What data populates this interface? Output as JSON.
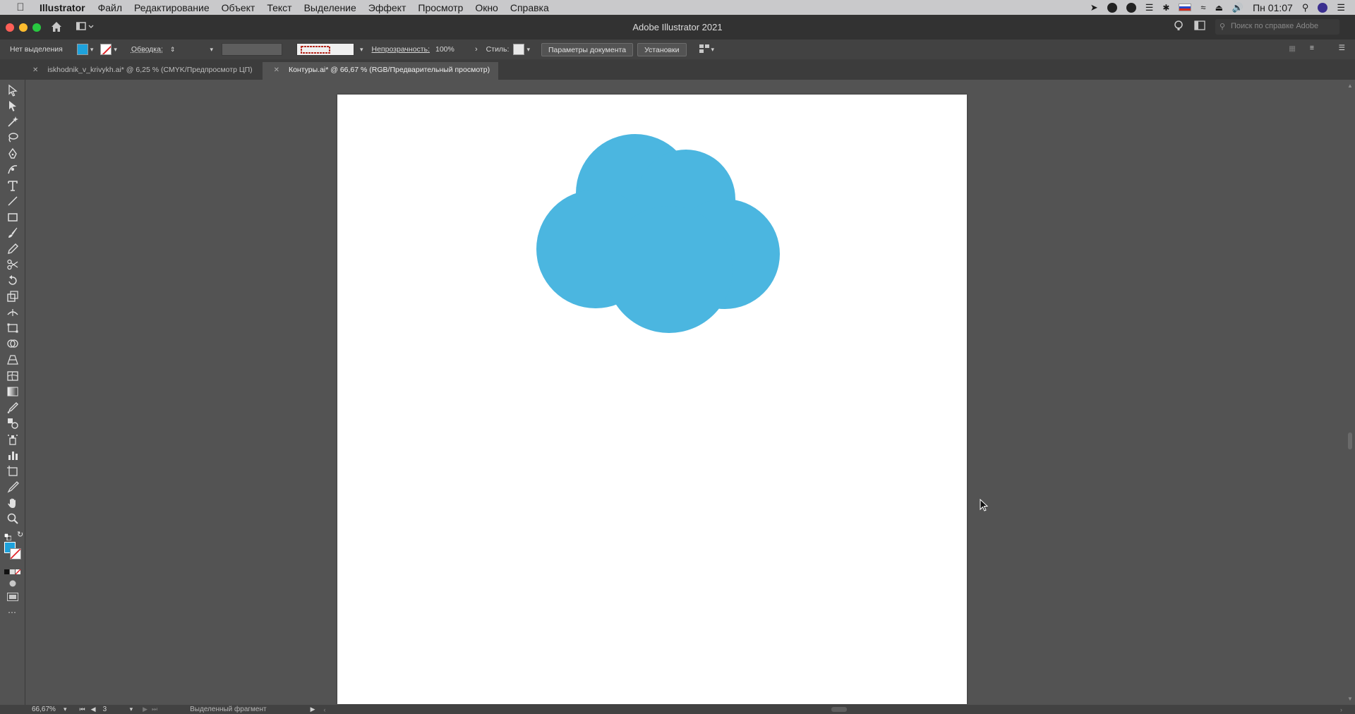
{
  "menubar": {
    "app_name": "Illustrator",
    "items": [
      "Файл",
      "Редактирование",
      "Объект",
      "Текст",
      "Выделение",
      "Эффект",
      "Просмотр",
      "Окно",
      "Справка"
    ],
    "clock": "Пн 01:07"
  },
  "titlebar": {
    "title": "Adobe Illustrator 2021",
    "help_search_placeholder": "Поиск по справке Adobe"
  },
  "controlbar": {
    "selection_label": "Нет выделения",
    "fill_color": "#2fa6d9",
    "stroke_label": "Обводка:",
    "opacity_label": "Непрозрачность:",
    "opacity_value": "100%",
    "style_label": "Стиль:",
    "document_setup_button": "Параметры документа",
    "preferences_button": "Установки"
  },
  "tabs": [
    {
      "label": "iskhodnik_v_krivykh.ai* @ 6,25 % (CMYK/Предпросмотр ЦП)",
      "active": false
    },
    {
      "label": "Контуры.ai* @ 66,67 % (RGB/Предварительный просмотр)",
      "active": true
    }
  ],
  "artwork": {
    "cloud_color": "#4bb6e0"
  },
  "statusbar": {
    "zoom": "66,67%",
    "artboard_number": "3",
    "status_text": "Выделенный фрагмент"
  },
  "colors": {
    "fill_swatch": "#1ea2dc",
    "cloud": "#4bb6e0"
  }
}
